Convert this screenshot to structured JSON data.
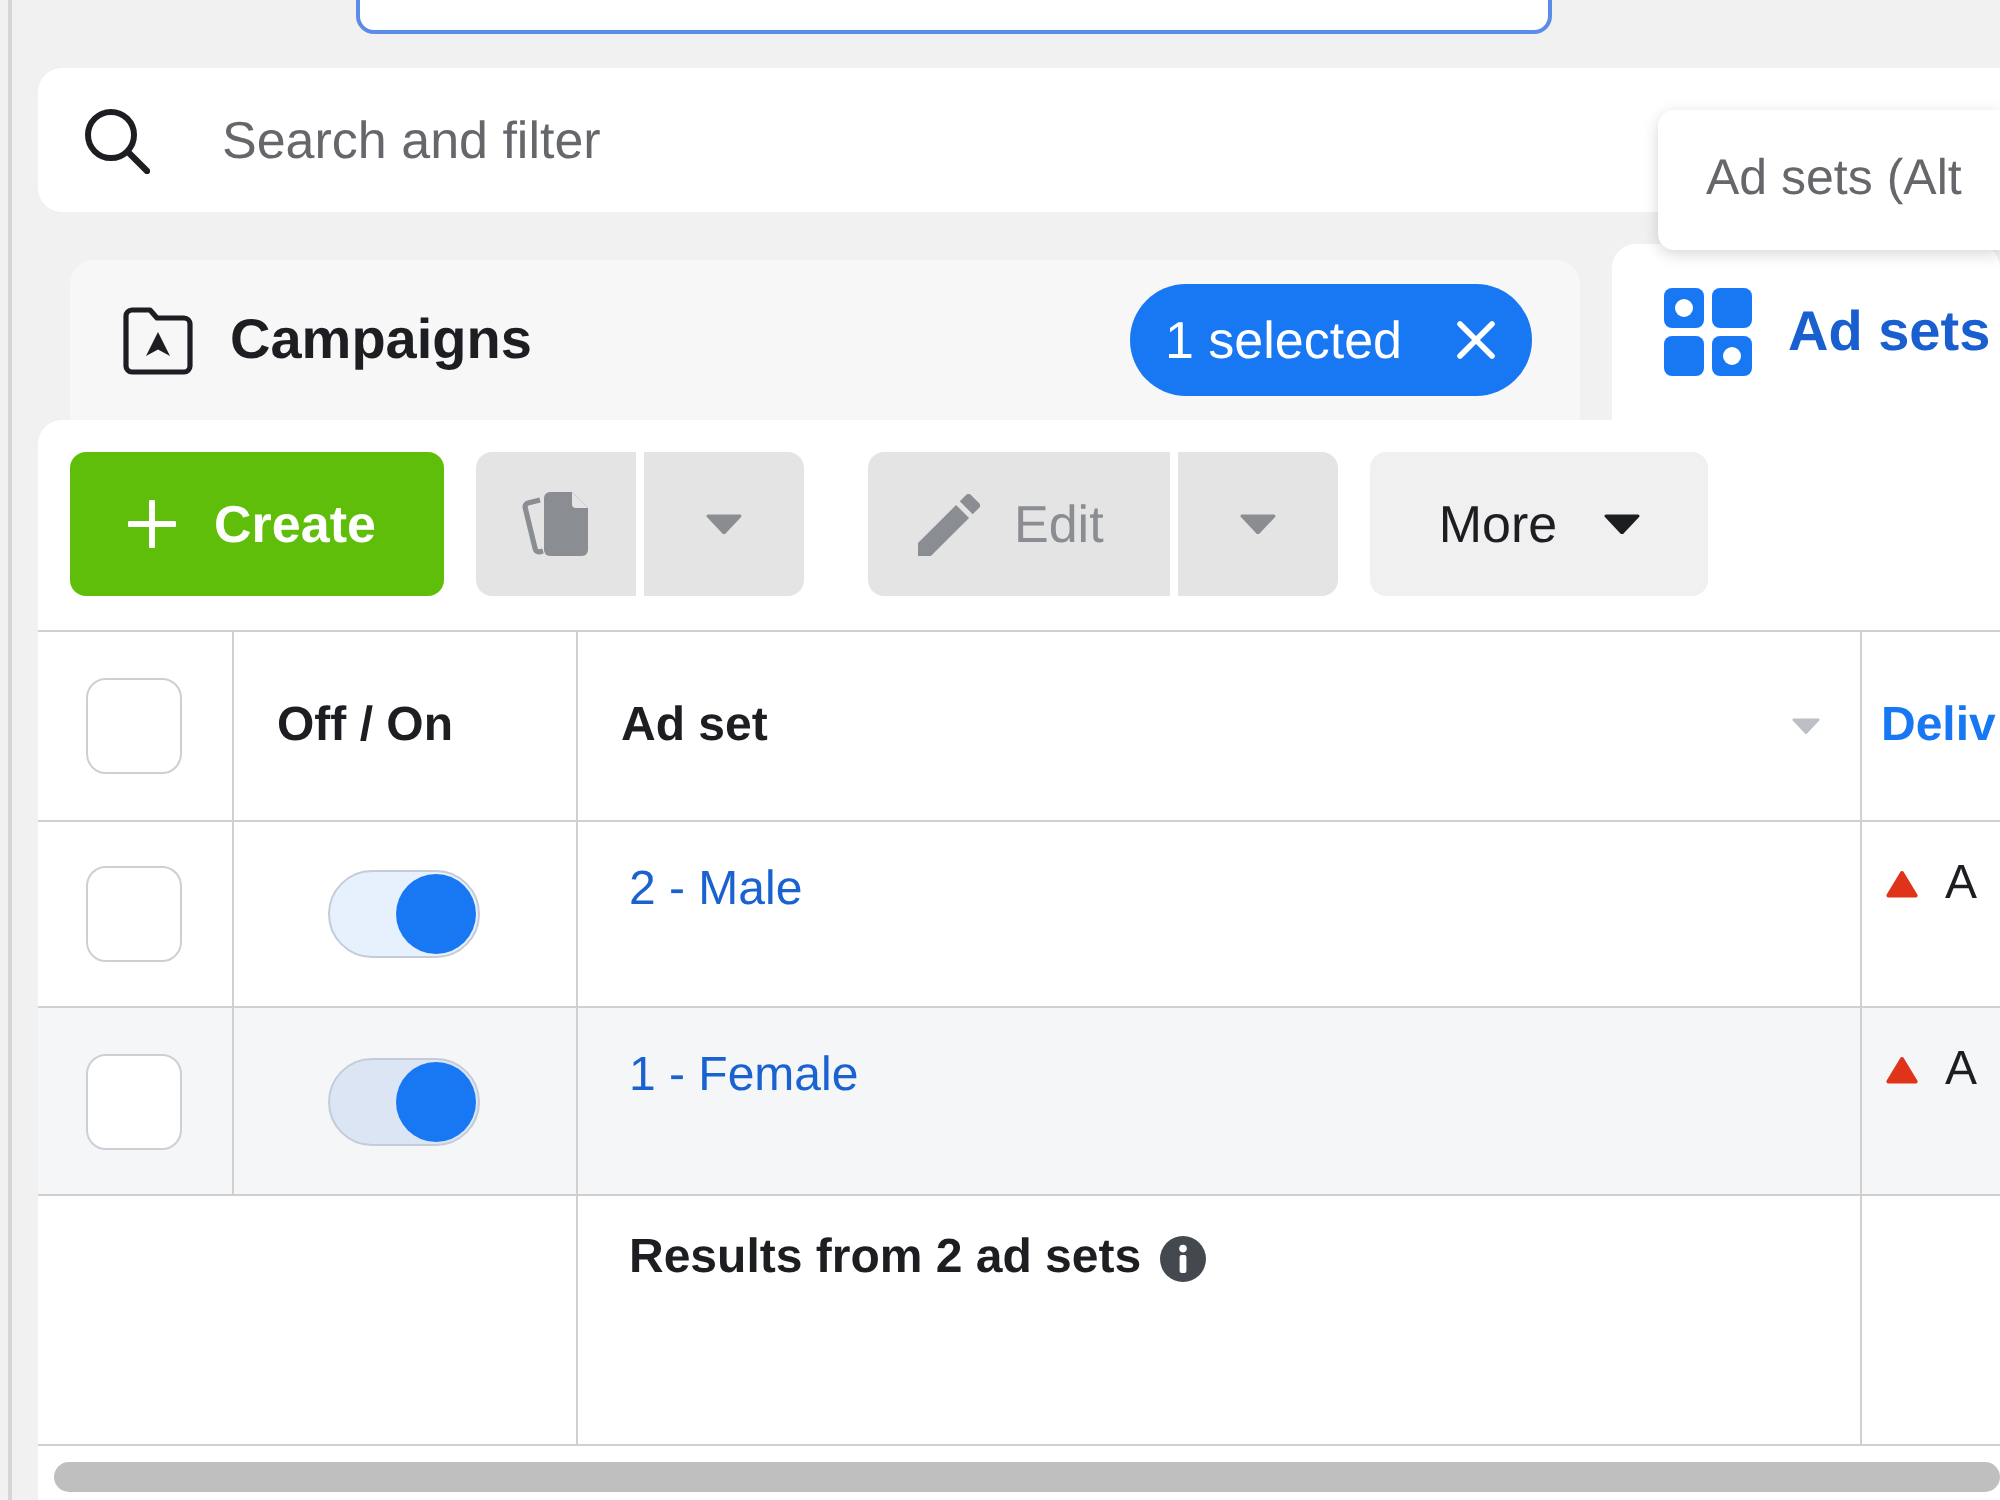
{
  "top_field": {
    "focused": true
  },
  "search": {
    "placeholder": "Search and filter"
  },
  "tooltip": {
    "text": "Ad sets (Alt"
  },
  "level_tabs": [
    {
      "kind": "campaigns",
      "label": "Campaigns",
      "selected": false,
      "selection_chip": "1 selected"
    },
    {
      "kind": "ad_sets",
      "label": "Ad sets",
      "selected": true
    }
  ],
  "toolbar": [
    {
      "kind": "create",
      "label": "Create",
      "disabled": false,
      "split": false
    },
    {
      "kind": "duplicate",
      "disabled": true,
      "split": true
    },
    {
      "kind": "edit",
      "label": "Edit",
      "disabled": true,
      "split": true
    },
    {
      "kind": "more",
      "label": "More",
      "disabled": false,
      "split": false
    }
  ],
  "table": {
    "select_all": {
      "checked": false
    },
    "columns": [
      {
        "label": "Off / On",
        "sorted": false,
        "dropdown": false
      },
      {
        "label": "Ad set",
        "sorted": false,
        "dropdown": true
      },
      {
        "label": "Deliv",
        "sorted": true,
        "dropdown": false
      }
    ],
    "rows": [
      {
        "checked": false,
        "on": true,
        "hovered": false,
        "name": "2 - Male",
        "delivery": {
          "warning": true,
          "text": "A"
        }
      },
      {
        "checked": false,
        "on": true,
        "hovered": true,
        "name": "1 - Female",
        "delivery": {
          "warning": true,
          "text": "A"
        }
      }
    ],
    "footer": {
      "label": "Results from 2 ad sets"
    }
  }
}
